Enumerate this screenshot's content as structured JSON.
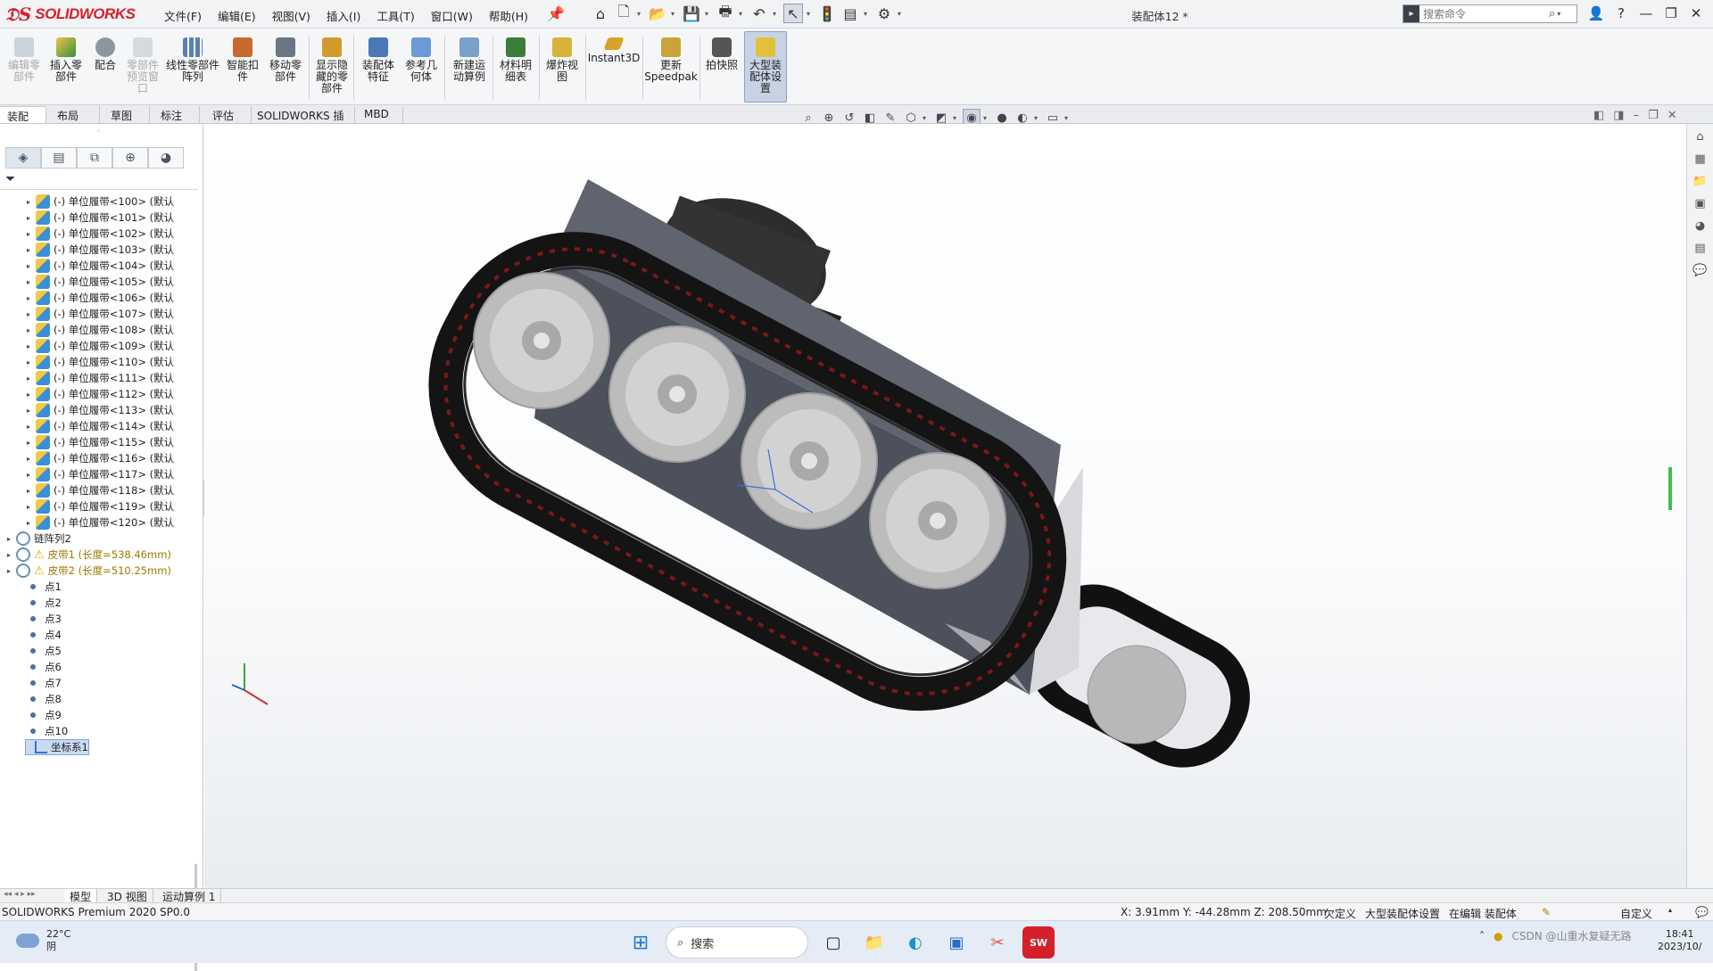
{
  "app": {
    "logo_text": "SOLIDWORKS",
    "document_title": "装配体12 *",
    "menu": [
      "文件(F)",
      "编辑(E)",
      "视图(V)",
      "插入(I)",
      "工具(T)",
      "窗口(W)",
      "帮助(H)"
    ],
    "search_placeholder": "搜索命令"
  },
  "ribbon": {
    "buttons": [
      {
        "label": "编辑零部件",
        "disabled": true
      },
      {
        "label": "插入零部件",
        "disabled": false
      },
      {
        "label": "配合",
        "disabled": false
      },
      {
        "label": "零部件预览窗口",
        "disabled": true
      },
      {
        "label": "线性零部件阵列",
        "disabled": false
      },
      {
        "label": "智能扣件",
        "disabled": false
      },
      {
        "label": "移动零部件",
        "disabled": false
      },
      {
        "label": "显示隐藏的零部件",
        "disabled": false
      },
      {
        "label": "装配体特征",
        "disabled": false
      },
      {
        "label": "参考几何体",
        "disabled": false
      },
      {
        "label": "新建运动算例",
        "disabled": false
      },
      {
        "label": "材料明细表",
        "disabled": false
      },
      {
        "label": "爆炸视图",
        "disabled": false
      },
      {
        "label": "Instant3D",
        "disabled": false
      },
      {
        "label": "更新Speedpak",
        "disabled": false
      },
      {
        "label": "拍快照",
        "disabled": false
      },
      {
        "label": "大型装配体设置",
        "disabled": false
      }
    ]
  },
  "command_tabs": [
    "装配体",
    "布局",
    "草图",
    "标注",
    "评估",
    "SOLIDWORKS 插件",
    "MBD"
  ],
  "tree": {
    "items": [
      {
        "label": "(-) 单位履带<100> (默认",
        "type": "part"
      },
      {
        "label": "(-) 单位履带<101> (默认",
        "type": "part"
      },
      {
        "label": "(-) 单位履带<102> (默认",
        "type": "part"
      },
      {
        "label": "(-) 单位履带<103> (默认",
        "type": "part"
      },
      {
        "label": "(-) 单位履带<104> (默认",
        "type": "part"
      },
      {
        "label": "(-) 单位履带<105> (默认",
        "type": "part"
      },
      {
        "label": "(-) 单位履带<106> (默认",
        "type": "part"
      },
      {
        "label": "(-) 单位履带<107> (默认",
        "type": "part"
      },
      {
        "label": "(-) 单位履带<108> (默认",
        "type": "part"
      },
      {
        "label": "(-) 单位履带<109> (默认",
        "type": "part"
      },
      {
        "label": "(-) 单位履带<110> (默认",
        "type": "part"
      },
      {
        "label": "(-) 单位履带<111> (默认",
        "type": "part"
      },
      {
        "label": "(-) 单位履带<112> (默认",
        "type": "part"
      },
      {
        "label": "(-) 单位履带<113> (默认",
        "type": "part"
      },
      {
        "label": "(-) 单位履带<114> (默认",
        "type": "part"
      },
      {
        "label": "(-) 单位履带<115> (默认",
        "type": "part"
      },
      {
        "label": "(-) 单位履带<116> (默认",
        "type": "part"
      },
      {
        "label": "(-) 单位履带<117> (默认",
        "type": "part"
      },
      {
        "label": "(-) 单位履带<118> (默认",
        "type": "part"
      },
      {
        "label": "(-) 单位履带<119> (默认",
        "type": "part"
      },
      {
        "label": "(-) 单位履带<120> (默认",
        "type": "part"
      },
      {
        "label": "链阵列2",
        "type": "pattern"
      },
      {
        "label": "皮带1 (长度=538.46mm)",
        "type": "belt-warn"
      },
      {
        "label": "皮带2 (长度=510.25mm)",
        "type": "belt-warn"
      },
      {
        "label": "点1",
        "type": "point"
      },
      {
        "label": "点2",
        "type": "point"
      },
      {
        "label": "点3",
        "type": "point"
      },
      {
        "label": "点4",
        "type": "point"
      },
      {
        "label": "点5",
        "type": "point"
      },
      {
        "label": "点6",
        "type": "point"
      },
      {
        "label": "点7",
        "type": "point"
      },
      {
        "label": "点8",
        "type": "point"
      },
      {
        "label": "点9",
        "type": "point"
      },
      {
        "label": "点10",
        "type": "point"
      },
      {
        "label": "坐标系1",
        "type": "coord",
        "selected": true
      }
    ]
  },
  "bottom_tabs": [
    "模型",
    "3D 视图",
    "运动算例 1"
  ],
  "status": {
    "product": "SOLIDWORKS Premium 2020 SP0.0",
    "coords": "X: 3.91mm Y: -44.28mm Z: 208.50mm",
    "state": "欠定义",
    "mode": "大型装配体设置",
    "editing": "在编辑 装配体",
    "custom": "自定义"
  },
  "taskbar": {
    "temp": "22°C",
    "weather": "阴",
    "search": "搜索",
    "time": "18:41",
    "date": "2023/10/",
    "watermark": "CSDN @山重水复疑无路"
  },
  "colors": {
    "brand_red": "#d4202b",
    "viewport_body": "#555a66",
    "track": "#1a1a1a",
    "track_link": "#8b1a1a",
    "wheel": "#bdbdbd"
  }
}
